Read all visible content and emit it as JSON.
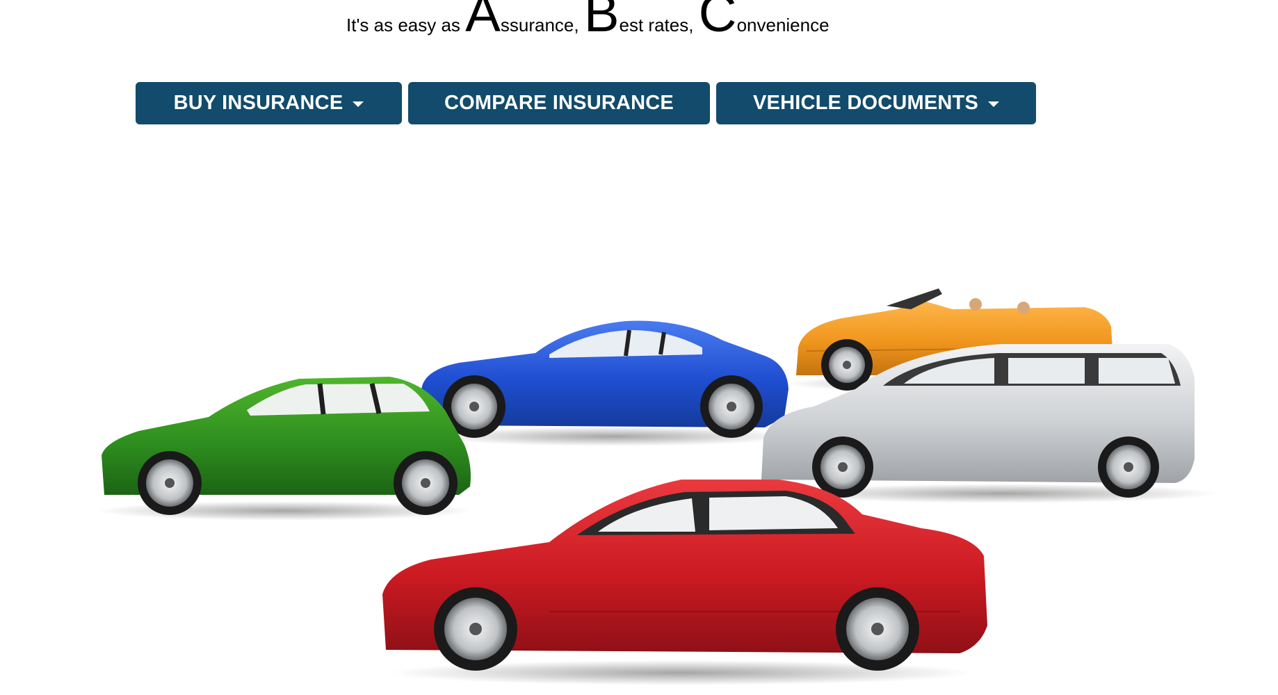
{
  "tagline": {
    "prefix": "It's as easy as ",
    "a_letter": "A",
    "a_rest": "ssurance, ",
    "b_letter": "B",
    "b_rest": "est rates, ",
    "c_letter": "C",
    "c_rest": "onvenience"
  },
  "nav": {
    "buy_label": "BUY INSURANCE",
    "compare_label": "COMPARE INSURANCE",
    "docs_label": "VEHICLE DOCUMENTS"
  },
  "colors": {
    "button_bg": "#124b6b",
    "button_text": "#ffffff",
    "car_green": "#2e8f1f",
    "car_blue": "#1f4fd1",
    "car_orange": "#f0961e",
    "car_silver": "#cfd2d5",
    "car_red": "#cc1a22"
  },
  "icons": {
    "dropdown": "caret-down-icon"
  }
}
